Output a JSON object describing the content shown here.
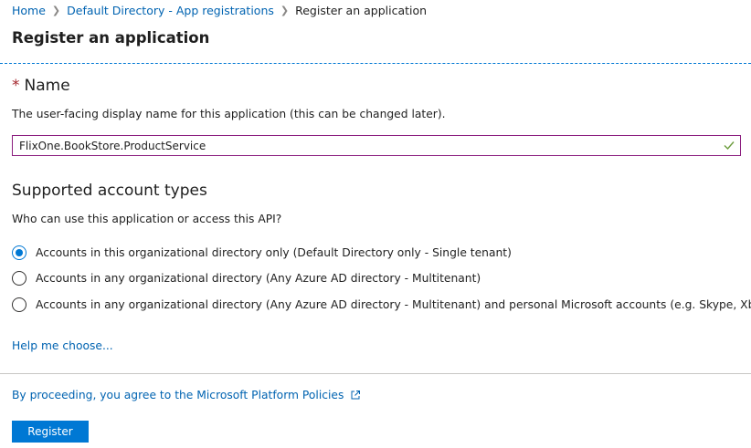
{
  "breadcrumb": {
    "home": "Home",
    "parent": "Default Directory - App registrations",
    "current": "Register an application"
  },
  "page_title": "Register an application",
  "name_section": {
    "required_marker": "*",
    "heading": "Name",
    "description": "The user-facing display name for this application (this can be changed later).",
    "input_value": "FlixOne.BookStore.ProductService"
  },
  "account_types": {
    "heading": "Supported account types",
    "question": "Who can use this application or access this API?",
    "options": [
      {
        "label": "Accounts in this organizational directory only (Default Directory only - Single tenant)",
        "selected": true
      },
      {
        "label": "Accounts in any organizational directory (Any Azure AD directory - Multitenant)",
        "selected": false
      },
      {
        "label": "Accounts in any organizational directory (Any Azure AD directory - Multitenant) and personal Microsoft accounts (e.g. Skype, Xbox)",
        "selected": false
      }
    ],
    "help_link": "Help me choose..."
  },
  "policy_text": "By proceeding, you agree to the Microsoft Platform Policies",
  "register_label": "Register",
  "colors": {
    "accent": "#0078d4",
    "link": "#0063b1",
    "input_border": "#8b1e7f",
    "valid_check": "#6b9c3c"
  }
}
